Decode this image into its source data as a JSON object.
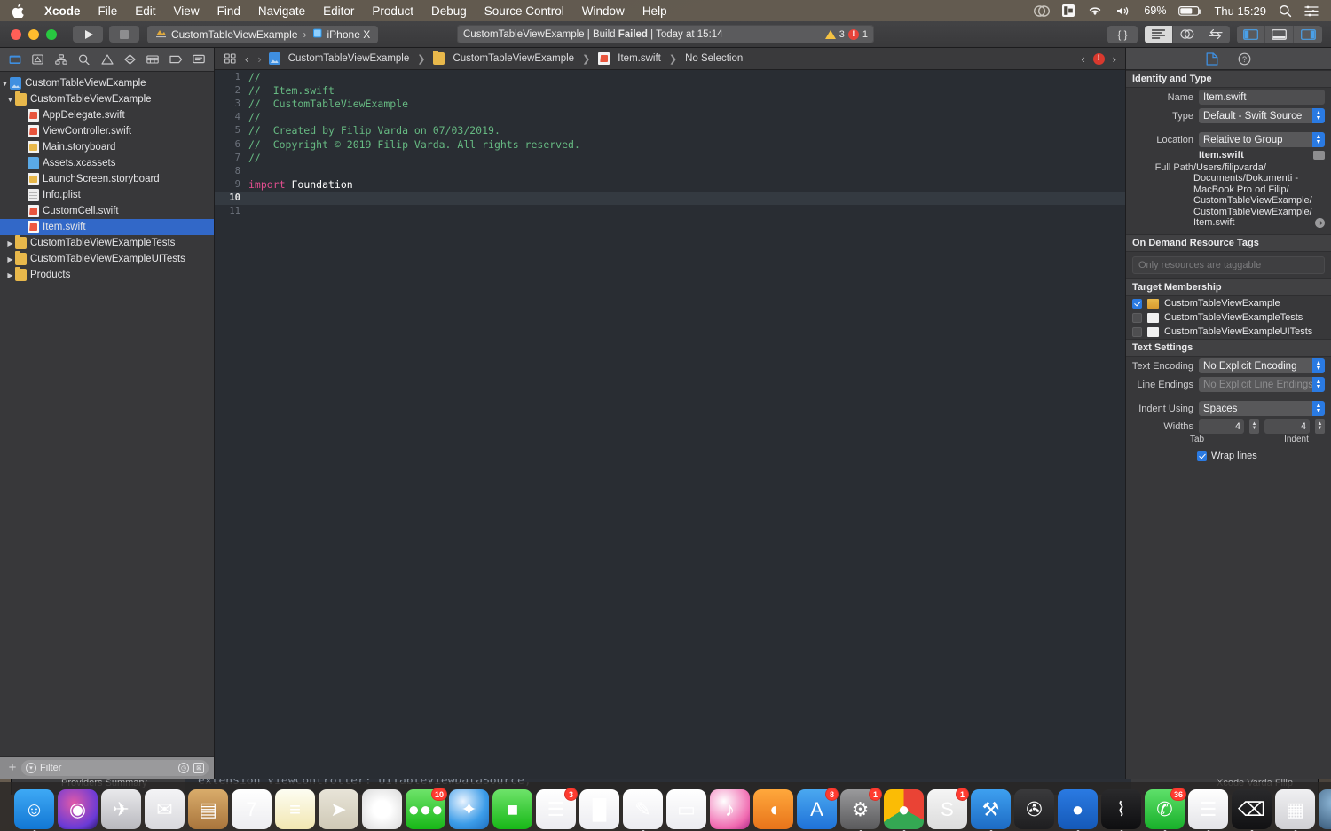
{
  "menubar": {
    "apple_icon": "apple-icon",
    "items": [
      {
        "label": "Xcode",
        "bold": true
      },
      {
        "label": "File",
        "bold": false
      },
      {
        "label": "Edit",
        "bold": false
      },
      {
        "label": "View",
        "bold": false
      },
      {
        "label": "Find",
        "bold": false
      },
      {
        "label": "Navigate",
        "bold": false
      },
      {
        "label": "Editor",
        "bold": false
      },
      {
        "label": "Product",
        "bold": false
      },
      {
        "label": "Debug",
        "bold": false
      },
      {
        "label": "Source Control",
        "bold": false
      },
      {
        "label": "Window",
        "bold": false
      },
      {
        "label": "Help",
        "bold": false
      }
    ],
    "status_icons": [
      "creative-cloud-icon",
      "dropbox-icon",
      "wifi-icon",
      "volume-icon"
    ],
    "battery_percent": "69%",
    "clock": "Thu 15:29",
    "search_icon": "search-icon",
    "control_center_icon": "control-center-icon"
  },
  "toolbar": {
    "run_label": "run-button",
    "stop_label": "stop-button",
    "scheme_name": "CustomTableViewExample",
    "scheme_separator": "›",
    "destination": "iPhone X",
    "status_text_prefix": "CustomTableViewExample | Build ",
    "status_text_bold": "Failed",
    "status_text_suffix": " | Today at 15:14",
    "warning_count": "3",
    "error_count": "1",
    "library_label": "{ }",
    "editor_modes": [
      "standard-editor",
      "assistant-editor",
      "version-editor"
    ],
    "panel_toggles": [
      "navigator-toggle",
      "debug-area-toggle",
      "inspector-toggle"
    ]
  },
  "navigator": {
    "tabs": [
      {
        "name": "project-navigator",
        "glyph": "▣",
        "active": true
      },
      {
        "name": "source-control-navigator",
        "glyph": "⌧",
        "active": false
      },
      {
        "name": "symbol-navigator",
        "glyph": "⚭",
        "active": false
      },
      {
        "name": "find-navigator",
        "glyph": "⌕",
        "active": false
      },
      {
        "name": "issue-navigator",
        "glyph": "⚠",
        "active": false
      },
      {
        "name": "test-navigator",
        "glyph": "◇",
        "active": false
      },
      {
        "name": "debug-navigator",
        "glyph": "☷",
        "active": false
      },
      {
        "name": "breakpoint-navigator",
        "glyph": "➡",
        "active": false
      },
      {
        "name": "report-navigator",
        "glyph": "⌨",
        "active": false
      }
    ],
    "tree": [
      {
        "label": "CustomTableViewExample",
        "indent": 0,
        "disclosure": "open",
        "icon": "project-icon",
        "selected": false
      },
      {
        "label": "CustomTableViewExample",
        "indent": 1,
        "disclosure": "open",
        "icon": "folder-icon",
        "selected": false
      },
      {
        "label": "AppDelegate.swift",
        "indent": 2,
        "disclosure": "none",
        "icon": "swift-file-icon",
        "selected": false
      },
      {
        "label": "ViewController.swift",
        "indent": 2,
        "disclosure": "none",
        "icon": "swift-file-icon",
        "selected": false
      },
      {
        "label": "Main.storyboard",
        "indent": 2,
        "disclosure": "none",
        "icon": "storyboard-icon",
        "selected": false
      },
      {
        "label": "Assets.xcassets",
        "indent": 2,
        "disclosure": "none",
        "icon": "assets-icon",
        "selected": false
      },
      {
        "label": "LaunchScreen.storyboard",
        "indent": 2,
        "disclosure": "none",
        "icon": "storyboard-icon",
        "selected": false
      },
      {
        "label": "Info.plist",
        "indent": 2,
        "disclosure": "none",
        "icon": "plist-icon",
        "selected": false
      },
      {
        "label": "CustomCell.swift",
        "indent": 2,
        "disclosure": "none",
        "icon": "swift-file-icon",
        "selected": false
      },
      {
        "label": "Item.swift",
        "indent": 2,
        "disclosure": "none",
        "icon": "swift-file-icon",
        "selected": true
      },
      {
        "label": "CustomTableViewExampleTests",
        "indent": 1,
        "disclosure": "closed",
        "icon": "folder-icon",
        "selected": false
      },
      {
        "label": "CustomTableViewExampleUITests",
        "indent": 1,
        "disclosure": "closed",
        "icon": "folder-icon",
        "selected": false
      },
      {
        "label": "Products",
        "indent": 1,
        "disclosure": "closed",
        "icon": "folder-icon",
        "selected": false
      }
    ],
    "add_button": "+",
    "filter_placeholder": "Filter",
    "filter_value": "",
    "filter_icons": [
      "recent-icon",
      "source-control-filter-icon"
    ]
  },
  "jumpbar": {
    "related_items_icon": "related-items-icon",
    "back_icon": "‹",
    "forward_icon": "›",
    "crumbs": [
      {
        "label": "CustomTableViewExample",
        "icon": "project-icon"
      },
      {
        "label": "CustomTableViewExample",
        "icon": "folder-icon"
      },
      {
        "label": "Item.swift",
        "icon": "swift-file-icon"
      },
      {
        "label": "No Selection",
        "icon": "none"
      }
    ],
    "issue_prev": "‹",
    "issue_next": "›",
    "issue_badge": "!"
  },
  "editor": {
    "current_line": 10,
    "lines": [
      {
        "n": 1,
        "tokens": [
          {
            "t": "//",
            "c": "comment"
          }
        ]
      },
      {
        "n": 2,
        "tokens": [
          {
            "t": "//  Item.swift",
            "c": "comment"
          }
        ]
      },
      {
        "n": 3,
        "tokens": [
          {
            "t": "//  CustomTableViewExample",
            "c": "comment"
          }
        ]
      },
      {
        "n": 4,
        "tokens": [
          {
            "t": "//",
            "c": "comment"
          }
        ]
      },
      {
        "n": 5,
        "tokens": [
          {
            "t": "//  Created by Filip Varda on 07/03/2019.",
            "c": "comment"
          }
        ]
      },
      {
        "n": 6,
        "tokens": [
          {
            "t": "//  Copyright © 2019 Filip Varda. All rights reserved.",
            "c": "comment"
          }
        ]
      },
      {
        "n": 7,
        "tokens": [
          {
            "t": "//",
            "c": "comment"
          }
        ]
      },
      {
        "n": 8,
        "tokens": [
          {
            "t": "",
            "c": "plain"
          }
        ]
      },
      {
        "n": 9,
        "tokens": [
          {
            "t": "import",
            "c": "kw"
          },
          {
            "t": " Foundation",
            "c": "id"
          }
        ]
      },
      {
        "n": 10,
        "tokens": [
          {
            "t": "",
            "c": "plain"
          }
        ]
      },
      {
        "n": 11,
        "tokens": [
          {
            "t": "",
            "c": "plain"
          }
        ]
      }
    ]
  },
  "inspector": {
    "tabs": [
      {
        "name": "file-inspector",
        "glyph": "⎘",
        "active": true
      },
      {
        "name": "quick-help-inspector",
        "glyph": "?",
        "active": false
      }
    ],
    "identity": {
      "header": "Identity and Type",
      "name_label": "Name",
      "name_value": "Item.swift",
      "type_label": "Type",
      "type_value": "Default - Swift Source",
      "location_label": "Location",
      "location_value": "Relative to Group",
      "location_file": "Item.swift",
      "fullpath_label": "Full Path",
      "fullpath_lines": [
        "/Users/filipvarda/",
        "Documents/Dokumenti -",
        "MacBook Pro od Filip/",
        "CustomTableViewExample/",
        "CustomTableViewExample/",
        "Item.swift"
      ]
    },
    "on_demand": {
      "header": "On Demand Resource Tags",
      "placeholder": "Only resources are taggable"
    },
    "target_membership": {
      "header": "Target Membership",
      "items": [
        {
          "label": "CustomTableViewExample",
          "checked": true,
          "icon": "app-target-icon"
        },
        {
          "label": "CustomTableViewExampleTests",
          "checked": false,
          "icon": "test-target-icon"
        },
        {
          "label": "CustomTableViewExampleUITests",
          "checked": false,
          "icon": "test-target-icon"
        }
      ]
    },
    "text_settings": {
      "header": "Text Settings",
      "encoding_label": "Text Encoding",
      "encoding_value": "No Explicit Encoding",
      "line_endings_label": "Line Endings",
      "line_endings_value": "No Explicit Line Endings",
      "indent_using_label": "Indent Using",
      "indent_using_value": "Spaces",
      "widths_label": "Widths",
      "tab_width": "4",
      "indent_width": "4",
      "tab_sublabel": "Tab",
      "indent_sublabel": "Indent",
      "wrap_lines_label": "Wrap lines",
      "wrap_lines_checked": true
    }
  },
  "background_window": {
    "code_text": "extension ViewController: UITableViewDataSource,",
    "left_label": "Providers Summary",
    "right_label": "Xcode   Varda Filip"
  },
  "dock": {
    "items": [
      {
        "name": "finder",
        "glyph": "☺",
        "bg": "linear-gradient(#3ea9f5,#1277d4)",
        "badge": "",
        "running": true
      },
      {
        "name": "siri",
        "glyph": "◉",
        "bg": "radial-gradient(circle at 40% 35%,#e05aa8,#6a3ad6 70%,#2a1a6a)",
        "badge": "",
        "running": false
      },
      {
        "name": "launchpad",
        "glyph": "✈",
        "bg": "linear-gradient(#e9e9ec,#b9b9be)",
        "badge": "",
        "running": false
      },
      {
        "name": "mail",
        "glyph": "✉",
        "bg": "linear-gradient(#f4f4f6,#d9d9dd)",
        "badge": "",
        "running": false
      },
      {
        "name": "contacts",
        "glyph": "▤",
        "bg": "linear-gradient(#d9ac6b,#a9753c)",
        "badge": "",
        "running": false
      },
      {
        "name": "calendar",
        "glyph": "7",
        "bg": "linear-gradient(#ffffff,#ededf0)",
        "badge": "",
        "running": false
      },
      {
        "name": "notes",
        "glyph": "≡",
        "bg": "linear-gradient(#fdfdf2,#f2e7b2)",
        "badge": "",
        "running": false
      },
      {
        "name": "maps",
        "glyph": "➤",
        "bg": "linear-gradient(#e8e4d8,#cfc9b6)",
        "badge": "",
        "running": false
      },
      {
        "name": "photos",
        "glyph": "✿",
        "bg": "radial-gradient(circle,#ffffff 30%,#dadada)",
        "badge": "",
        "running": false
      },
      {
        "name": "messages",
        "glyph": "●●●",
        "bg": "linear-gradient(#6ee36a,#17b817)",
        "badge": "10",
        "running": false
      },
      {
        "name": "safari",
        "glyph": "✦",
        "bg": "radial-gradient(circle at 35% 30%,#eaf4ff,#3c9ce8 60%,#1d6fc0)",
        "badge": "",
        "running": false
      },
      {
        "name": "facetime",
        "glyph": "■",
        "bg": "linear-gradient(#6ee36a,#17b817)",
        "badge": "",
        "running": false
      },
      {
        "name": "reminders",
        "glyph": "☰",
        "bg": "linear-gradient(#ffffff,#ececf0)",
        "badge": "3",
        "running": false
      },
      {
        "name": "numbers",
        "glyph": "█",
        "bg": "linear-gradient(#ffffff,#ececf0)",
        "badge": "",
        "running": false
      },
      {
        "name": "pages",
        "glyph": "✎",
        "bg": "linear-gradient(#ffffff,#ececf0)",
        "badge": "",
        "running": true
      },
      {
        "name": "keynote",
        "glyph": "▭",
        "bg": "linear-gradient(#ffffff,#ececf0)",
        "badge": "",
        "running": false
      },
      {
        "name": "itunes",
        "glyph": "♪",
        "bg": "radial-gradient(circle at 35% 30%,#ffffff,#f06ab0 70%,#b02a8a)",
        "badge": "",
        "running": false
      },
      {
        "name": "ibooks",
        "glyph": "◖",
        "bg": "linear-gradient(#ffa83c,#e8741a)",
        "badge": "",
        "running": false
      },
      {
        "name": "app-store",
        "glyph": "A",
        "bg": "linear-gradient(#4aa8f0,#1f72d8)",
        "badge": "8",
        "running": false
      },
      {
        "name": "system-preferences",
        "glyph": "⚙",
        "bg": "linear-gradient(#9a9a9c,#5a5a5c)",
        "badge": "1",
        "running": true
      },
      {
        "name": "google-chrome",
        "glyph": "●",
        "bg": "conic-gradient(#ea4335 0 33%,#34a853 0 66%,#fbbc05 0 100%)",
        "badge": "",
        "running": true
      },
      {
        "name": "sublime-text",
        "glyph": "S",
        "bg": "linear-gradient(#f5f5f5,#dcdcdc)",
        "badge": "1",
        "running": false
      },
      {
        "name": "xcode",
        "glyph": "⚒",
        "bg": "linear-gradient(#3ea0f0,#1d6bc4)",
        "badge": "",
        "running": true
      },
      {
        "name": "sublime-merge",
        "glyph": "✇",
        "bg": "linear-gradient(#3a3a3c,#1e1e20)",
        "badge": "",
        "running": false
      },
      {
        "name": "sourcetree",
        "glyph": "●",
        "bg": "linear-gradient(#2a7ae2,#1559b8)",
        "badge": "",
        "running": true
      },
      {
        "name": "activity-monitor",
        "glyph": "⌇",
        "bg": "linear-gradient(#2a2a2c,#0e0e10)",
        "badge": "",
        "running": true
      },
      {
        "name": "whatsapp",
        "glyph": "✆",
        "bg": "linear-gradient(#5ee06a,#18b02a)",
        "badge": "36",
        "running": true
      },
      {
        "name": "textedit",
        "glyph": "☰",
        "bg": "linear-gradient(#ffffff,#e4e4e8)",
        "badge": "",
        "running": true
      },
      {
        "name": "terminal",
        "glyph": "⌫",
        "bg": "linear-gradient(#2a2a2c,#111113)",
        "badge": "",
        "running": true
      },
      {
        "name": "calculator",
        "glyph": "▦",
        "bg": "linear-gradient(#f0f0f2,#d0d0d4)",
        "badge": "",
        "running": true
      },
      {
        "name": "quicktime",
        "glyph": "▶",
        "bg": "radial-gradient(circle at 38% 32%,#8fb8d8,#2a4a6a)",
        "badge": "",
        "running": true
      },
      {
        "name": "preview",
        "glyph": "◱",
        "bg": "linear-gradient(#eef4f8,#b9cfe0)",
        "badge": "",
        "running": true
      },
      {
        "name": "xcode-beta",
        "glyph": "⚒",
        "bg": "linear-gradient(#3ea0f0,#1d6bc4)",
        "badge": "",
        "running": false
      }
    ],
    "minimized": [
      {
        "name": "minimized-window-1",
        "bg": "linear-gradient(#f4f4f6,#c9c9cd)"
      },
      {
        "name": "minimized-window-2",
        "bg": "linear-gradient(#fdfdfd,#dddde1)"
      },
      {
        "name": "minimized-window-3",
        "bg": "linear-gradient(#2a2a2c,#141416)"
      },
      {
        "name": "minimized-window-4",
        "bg": "linear-gradient(#1e1e20,#0c0c0e)"
      },
      {
        "name": "minimized-window-5",
        "bg": "linear-gradient(#f0f0f2,#cfcfd3)"
      },
      {
        "name": "minimized-window-6",
        "bg": "linear-gradient(#1a3a5a,#0c1c2c)"
      },
      {
        "name": "minimized-window-7",
        "bg": "linear-gradient(#2a4a6a,#16263a)"
      }
    ],
    "trash_name": "trash"
  }
}
